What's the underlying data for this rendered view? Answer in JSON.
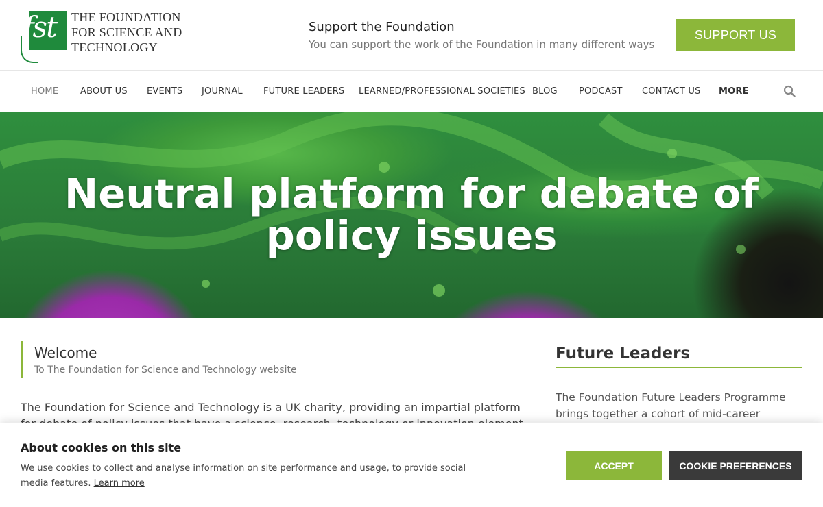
{
  "header": {
    "logo_mark": "fst",
    "logo_lines": [
      "THE FOUNDATION",
      "FOR SCIENCE AND",
      "TECHNOLOGY"
    ],
    "support_title": "Support the Foundation",
    "support_sub": "You can support the work of the Foundation in many different ways",
    "support_button": "SUPPORT US"
  },
  "nav": {
    "items": [
      {
        "label": "HOME",
        "active": true
      },
      {
        "label": "ABOUT US"
      },
      {
        "label": "EVENTS"
      },
      {
        "label": "JOURNAL"
      },
      {
        "label": "FUTURE LEADERS"
      },
      {
        "label": "LEARNED/PROFESSIONAL SOCIETIES"
      },
      {
        "label": "BLOG"
      },
      {
        "label": "PODCAST"
      },
      {
        "label": "CONTACT US"
      },
      {
        "label": "MORE"
      }
    ],
    "search_icon": "search-icon"
  },
  "hero": {
    "title": "Neutral platform for debate of policy issues"
  },
  "welcome": {
    "title": "Welcome",
    "subtitle": "To The Foundation for Science and Technology website",
    "body": "The Foundation for Science and Technology is a UK charity, providing an impartial platform for debate of policy issues that have a science, research, technology or innovation element. Established"
  },
  "sidebar": {
    "title": "Future Leaders",
    "text": "The Foundation Future Leaders Programme brings together a cohort of mid-career"
  },
  "cookie": {
    "title": "About cookies on this site",
    "text": "We use cookies to collect and analyse information on site performance and usage, to provide social media features.",
    "link": "Learn more",
    "accept": "ACCEPT",
    "preferences": "COOKIE PREFERENCES"
  },
  "colors": {
    "accent": "#8cb73a",
    "logo_green": "#1f8a3c",
    "dark_button": "#3a3a3a"
  }
}
